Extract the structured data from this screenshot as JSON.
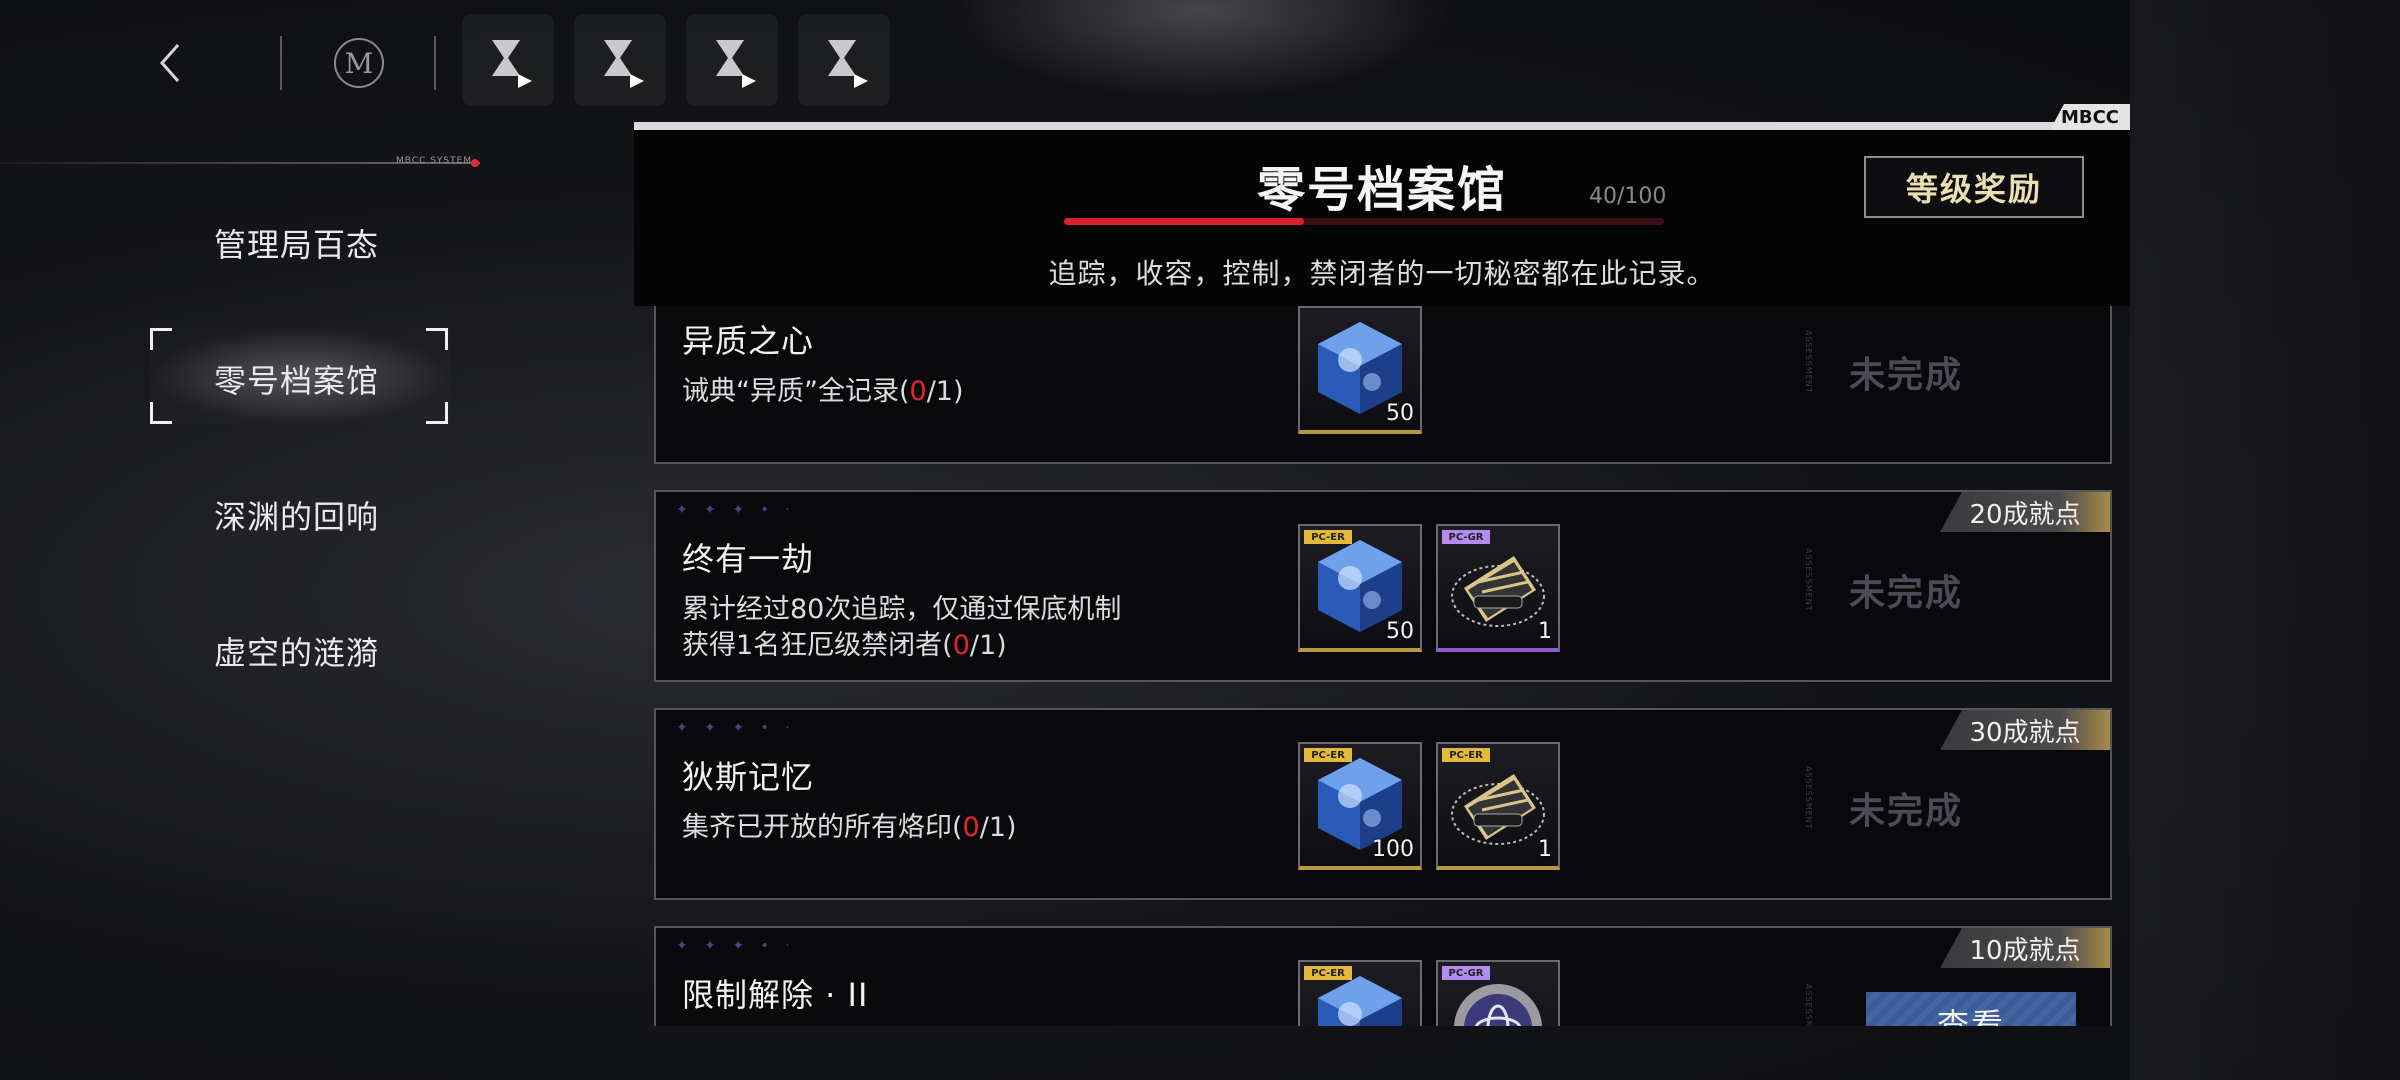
{
  "nav": {
    "back_icon": "chevron-left-icon",
    "logo": "M",
    "tool_icons": [
      "hourglass-play-icon",
      "hourglass-play-icon",
      "hourglass-play-icon",
      "hourglass-play-icon"
    ]
  },
  "sidebar": {
    "system_label": "MBCC SYSTEM",
    "items": [
      {
        "label": "管理局百态"
      },
      {
        "label": "零号档案馆",
        "active": true
      },
      {
        "label": "深渊的回响"
      },
      {
        "label": "虚空的涟漪"
      }
    ]
  },
  "panel": {
    "tag": "MBCC",
    "title": "零号档案馆",
    "progress": {
      "current": 40,
      "max": 100,
      "text": "40/100"
    },
    "subtitle": "追踪，收容，控制，禁闭者的一切秘密都在此记录。",
    "reward_button": "等级奖励"
  },
  "achievements": [
    {
      "title": "异质之心",
      "desc_prefix": "诫典“异质”全记录(",
      "desc_progress": "0",
      "desc_suffix": "/1)",
      "points": "",
      "status": "未完成",
      "vertical_text": "ASSESSMENT",
      "items": [
        {
          "type": "cube",
          "tag": "",
          "count": "50",
          "rarity": "gold"
        }
      ]
    },
    {
      "title": "终有一劫",
      "desc_prefix": "累计经过80次追踪，仅通过保底机制获得1名狂厄级禁闭者(",
      "desc_progress": "0",
      "desc_suffix": "/1)",
      "points": "20成就点",
      "status": "未完成",
      "vertical_text": "ASSESSMENT",
      "items": [
        {
          "type": "cube",
          "tag": "PC-ER",
          "count": "50",
          "rarity": "gold"
        },
        {
          "type": "ticket",
          "tag": "PC-GR",
          "count": "1",
          "rarity": "purple"
        }
      ]
    },
    {
      "title": "狄斯记忆",
      "desc_prefix": "集齐已开放的所有烙印(",
      "desc_progress": "0",
      "desc_suffix": "/1)",
      "points": "30成就点",
      "status": "未完成",
      "vertical_text": "ASSESSMENT",
      "items": [
        {
          "type": "cube",
          "tag": "PC-ER",
          "count": "100",
          "rarity": "gold"
        },
        {
          "type": "ticket",
          "tag": "PC-ER",
          "count": "1",
          "rarity": "gold"
        }
      ]
    },
    {
      "title": "限制解除 · II",
      "desc_prefix": "",
      "desc_progress": "",
      "desc_suffix": "",
      "points": "10成就点",
      "status": "查看",
      "vertical_text": "ASSESSMENT",
      "items": [
        {
          "type": "cube",
          "tag": "PC-ER",
          "count": "",
          "rarity": "gold"
        },
        {
          "type": "seal",
          "tag": "PC-GR",
          "count": "",
          "rarity": "purple"
        }
      ]
    }
  ],
  "colors": {
    "accent_red": "#e8232f",
    "gold": "#b8973d",
    "view_button": "#3b5a98",
    "status_incomplete": "#4a4b55"
  }
}
